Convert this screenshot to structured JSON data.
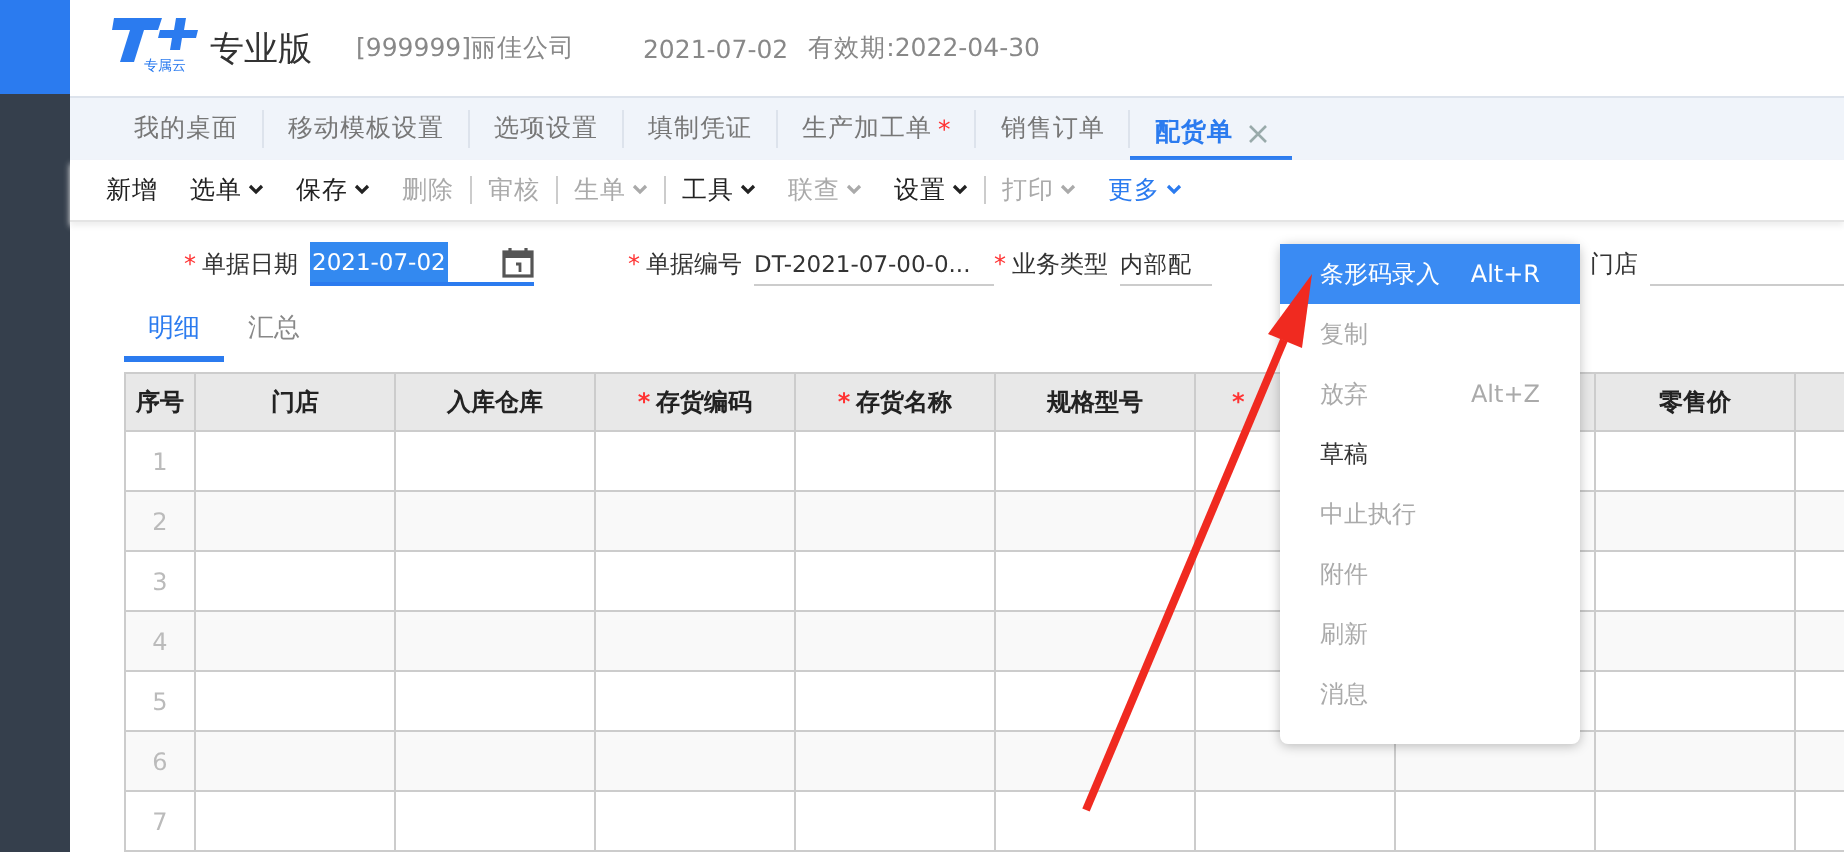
{
  "header": {
    "logo_badge": "专属云",
    "edition": "专业版",
    "company": "[999999]丽佳公司",
    "date": "2021-07-02",
    "validity": "有效期:2022-04-30"
  },
  "tabs": [
    {
      "label": "我的桌面",
      "selected": false,
      "closable": false
    },
    {
      "label": "移动模板设置",
      "selected": false,
      "closable": false
    },
    {
      "label": "选项设置",
      "selected": false,
      "closable": false
    },
    {
      "label": "填制凭证",
      "selected": false,
      "closable": false
    },
    {
      "label": "生产加工单",
      "mark": "*",
      "selected": false,
      "closable": false
    },
    {
      "label": "销售订单",
      "selected": false,
      "closable": false
    },
    {
      "label": "配货单",
      "selected": true,
      "closable": true
    }
  ],
  "toolbar": [
    {
      "label": "新增",
      "dropdown": false,
      "disabled": false,
      "active": false,
      "divider": false
    },
    {
      "label": "选单",
      "dropdown": true,
      "disabled": false,
      "active": false,
      "divider": false
    },
    {
      "label": "保存",
      "dropdown": true,
      "disabled": false,
      "active": false,
      "divider": false
    },
    {
      "label": "删除",
      "dropdown": false,
      "disabled": true,
      "active": false,
      "divider": true
    },
    {
      "label": "审核",
      "dropdown": false,
      "disabled": true,
      "active": false,
      "divider": true
    },
    {
      "label": "生单",
      "dropdown": true,
      "disabled": true,
      "active": false,
      "divider": true
    },
    {
      "label": "工具",
      "dropdown": true,
      "disabled": false,
      "active": false,
      "divider": false
    },
    {
      "label": "联查",
      "dropdown": true,
      "disabled": true,
      "active": false,
      "divider": false
    },
    {
      "label": "设置",
      "dropdown": true,
      "disabled": false,
      "active": false,
      "divider": true
    },
    {
      "label": "打印",
      "dropdown": true,
      "disabled": true,
      "active": false,
      "divider": false
    },
    {
      "label": "更多",
      "dropdown": true,
      "disabled": false,
      "active": true,
      "divider": false
    }
  ],
  "form": [
    {
      "mark": "*",
      "label": "单据日期",
      "value": "2021-07-02",
      "kind": "date"
    },
    {
      "mark": "*",
      "label": "单据编号",
      "value": "DT-2021-07-00-0...",
      "kind": "text"
    },
    {
      "mark": "*",
      "label": "业务类型",
      "value": "内部配",
      "kind": "text"
    },
    {
      "label": "门店",
      "kind": "text"
    }
  ],
  "sub_tabs": [
    {
      "label": "明细",
      "selected": true
    },
    {
      "label": "汇总",
      "selected": false
    }
  ],
  "table": {
    "columns": [
      {
        "label": "序号"
      },
      {
        "label": "门店"
      },
      {
        "label": "入库仓库"
      },
      {
        "mark": "*",
        "label": "存货编码"
      },
      {
        "mark": "*",
        "label": "存货名称"
      },
      {
        "label": "规格型号"
      },
      {
        "mark": "*"
      },
      {},
      {
        "label": "零售价"
      },
      {}
    ],
    "rows": [
      "1",
      "2",
      "3",
      "4",
      "5",
      "6",
      "7"
    ]
  },
  "more_menu": [
    {
      "label": "条形码录入",
      "shortcut": "Alt+R",
      "selected": true,
      "disabled": false
    },
    {
      "label": "复制",
      "selected": false,
      "disabled": true
    },
    {
      "label": "放弃",
      "shortcut": "Alt+Z",
      "selected": false,
      "disabled": true
    },
    {
      "label": "草稿",
      "selected": false,
      "disabled": false
    },
    {
      "label": "中止执行",
      "selected": false,
      "disabled": true
    },
    {
      "label": "附件",
      "selected": false,
      "disabled": true
    },
    {
      "label": "刷新",
      "selected": false,
      "disabled": true
    },
    {
      "label": "消息",
      "selected": false,
      "disabled": true
    }
  ]
}
